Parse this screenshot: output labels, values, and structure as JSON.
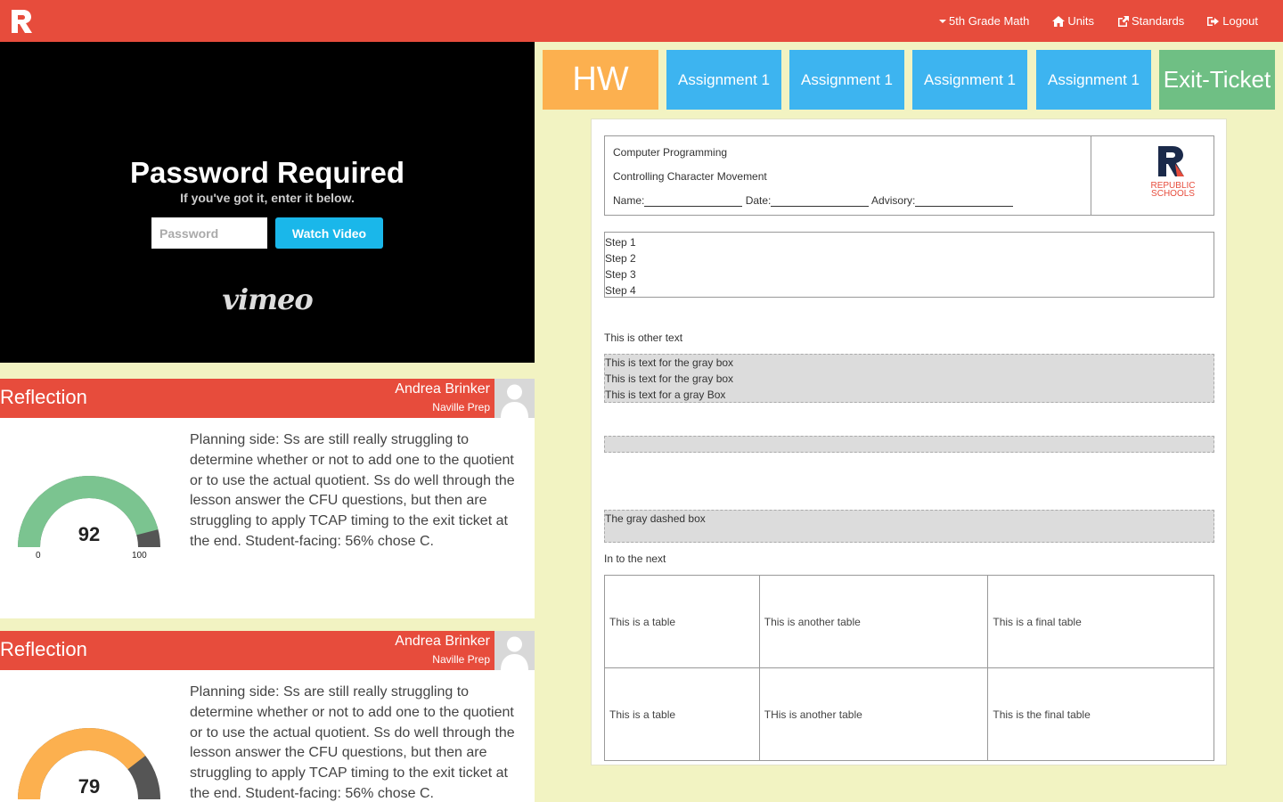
{
  "nav": {
    "brand_icon": "logo-r-icon",
    "links": [
      {
        "label": "5th Grade Math",
        "icon": "caret-down-icon"
      },
      {
        "label": "Units",
        "icon": "home-icon"
      },
      {
        "label": "Standards",
        "icon": "external-link-icon"
      },
      {
        "label": "Logout",
        "icon": "logout-icon"
      }
    ]
  },
  "video": {
    "title": "Password Required",
    "subtitle": "If you've got it, enter it below.",
    "password_placeholder": "Password",
    "button_label": "Watch Video",
    "brand": "vimeo"
  },
  "reflections": [
    {
      "title": "Reflection",
      "author": "Andrea Brinker",
      "school": "Naville Prep",
      "score": "92",
      "min": "0",
      "max": "100",
      "gauge_color": "#7bc490",
      "text": "Planning side: Ss are still really struggling to determine whether or not to add one to the quotient or to use the actual quotient. Ss do well through the lesson answer the CFU questions, but then are struggling to apply TCAP timing to the exit ticket at the end. Student-facing: 56% chose C."
    },
    {
      "title": "Reflection",
      "author": "Andrea Brinker",
      "school": "Naville Prep",
      "score": "79",
      "gauge_color": "#fcb04f",
      "text": "Planning side: Ss are still really struggling to determine whether or not to add one to the quotient or to use the actual quotient. Ss do well through the lesson answer the CFU questions, but then are struggling to apply TCAP timing to the exit ticket at the end. Student-facing: 56% chose C."
    }
  ],
  "tabs": {
    "hw": "HW",
    "assignments": [
      "Assignment 1",
      "Assignment 1",
      "Assignment 1",
      "Assignment 1"
    ],
    "exit": "Exit-Ticket"
  },
  "doc": {
    "course": "Computer Programming",
    "lesson": "Controlling Character Movement",
    "name_label": "Name:",
    "date_label": "Date:",
    "advisory_label": "Advisory:",
    "logo_text_1": "REPUBLIC",
    "logo_text_2": "SCHOOLS",
    "steps": [
      "Step 1",
      "Step 2",
      "Step 3",
      "Step 4"
    ],
    "other_text": "This is other text",
    "gray_box": [
      "This is text for the gray box",
      "This is text for the gray box",
      "This is text for a gray Box"
    ],
    "dashed_box": "The gray dashed box",
    "into_next": "In to the next",
    "table": [
      [
        "This is a table",
        "This is another table",
        "This is a final table"
      ],
      [
        "This is a table",
        "THis is another table",
        "This is the final table"
      ]
    ]
  }
}
